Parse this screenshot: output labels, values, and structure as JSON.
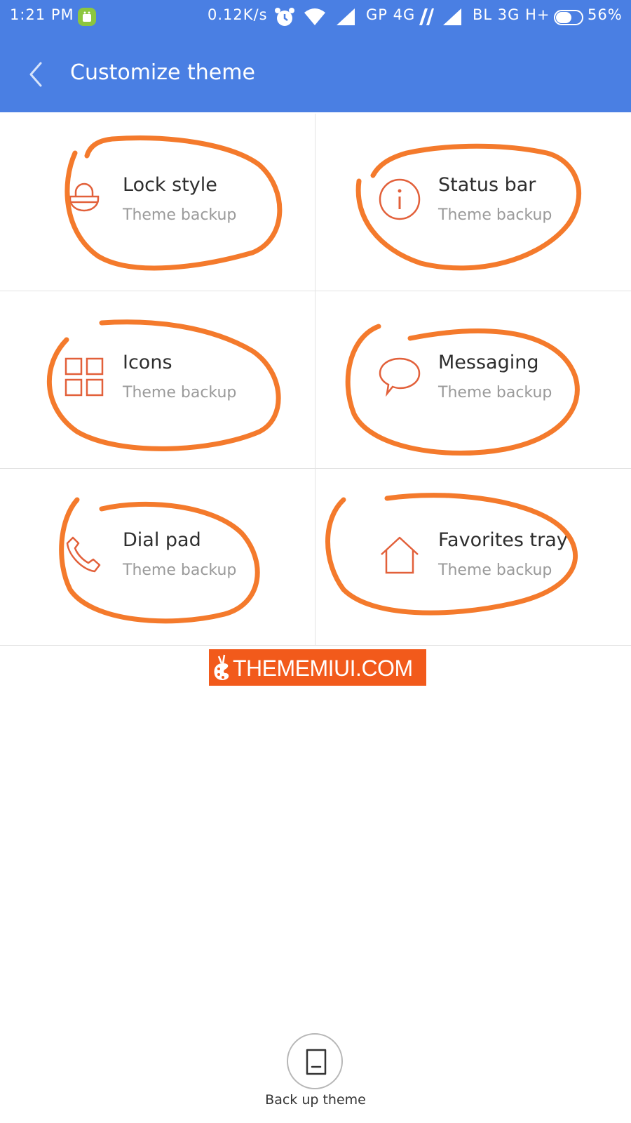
{
  "status_bar": {
    "time": "1:21 PM",
    "speed": "0.12K/s",
    "carrier1": "GP 4G",
    "carrier2": "BL 3G H+",
    "battery": "56%",
    "icons": [
      "android-notification-icon",
      "alarm-icon",
      "wifi-icon",
      "signal-icon",
      "battery-icon"
    ]
  },
  "header": {
    "title": "Customize theme",
    "back_icon": "chevron-left-icon"
  },
  "tiles": [
    {
      "title": "Lock style",
      "subtitle": "Theme backup",
      "icon": "lock-icon"
    },
    {
      "title": "Status bar",
      "subtitle": "Theme backup",
      "icon": "info-icon"
    },
    {
      "title": "Icons",
      "subtitle": "Theme backup",
      "icon": "grid-icon"
    },
    {
      "title": "Messaging",
      "subtitle": "Theme backup",
      "icon": "chat-bubble-icon"
    },
    {
      "title": "Dial pad",
      "subtitle": "Theme backup",
      "icon": "phone-icon"
    },
    {
      "title": "Favorites tray",
      "subtitle": "Theme backup",
      "icon": "home-icon"
    }
  ],
  "watermark": {
    "text": "THEMEMIUI.COM"
  },
  "footer": {
    "button_label": "Back up theme",
    "button_icon": "backup-icon"
  },
  "colors": {
    "header": "#4a7fe3",
    "accent_icon": "#e2603a",
    "annotation": "#f47a2c",
    "watermark_bg": "#f25a1b",
    "subtitle": "#9a9a9a"
  }
}
